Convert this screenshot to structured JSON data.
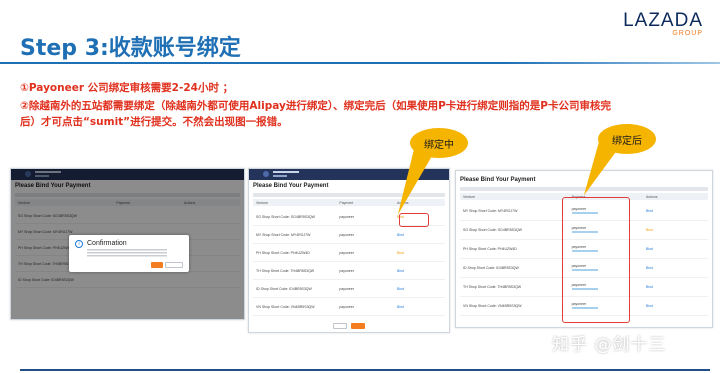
{
  "header": {
    "title": "Step 3:收款账号绑定",
    "logo": {
      "brand": "LAZADA",
      "group": "GROUP"
    }
  },
  "notes": [
    "①Payoneer 公司绑定审核需要2-24小时 ；",
    "②除越南外的五站都需要绑定（除越南外都可使用Alipay进行绑定）、绑定完后（如果使用P卡进行绑定则指的是P卡公司审核完后）才可点击“sumit”进行提交。不然会出现图一报错。"
  ],
  "callouts": {
    "binding": "绑定中",
    "bound": "绑定后"
  },
  "screenshot1": {
    "panel_title": "Please Bind Your Payment",
    "columns": [
      "Venture",
      "Payment",
      "Actions"
    ],
    "rows": [
      {
        "venture": "SG Shop Short Code: SG4BR5S3QW",
        "payment": "",
        "action": ""
      },
      {
        "venture": "MY Shop Short Code: MY4RGJ7W",
        "payment": "",
        "action": ""
      },
      {
        "venture": "PH Shop Short Code: PH4UZW4D",
        "payment": "",
        "action": ""
      },
      {
        "venture": "TH Shop Short Code: TH4BR5S3QW",
        "payment": "",
        "action": ""
      },
      {
        "venture": "ID Shop Short Code: ID4BR5S3QW",
        "payment": "",
        "action": ""
      }
    ],
    "dialog": {
      "title": "Confirmation",
      "icon": "info-icon",
      "ok_label": "Ok",
      "cancel_label": "Cancel"
    }
  },
  "screenshot2": {
    "panel_title": "Please Bind Your Payment",
    "columns": [
      "Venture",
      "Payment",
      "Actions"
    ],
    "rows": [
      {
        "venture": "SG Shop Short Code: SG4BR5S3QW",
        "payment": "payoneer",
        "action": "Bind",
        "status": "review"
      },
      {
        "venture": "MY Shop Short Code: MY4RGJ7W",
        "payment": "payoneer",
        "action": "Bind",
        "status": "bind"
      },
      {
        "venture": "PH Shop Short Code: PH4UZW4D",
        "payment": "payoneer",
        "action": "Bind",
        "status": "review"
      },
      {
        "venture": "TH Shop Short Code: TH4BR5S3QW",
        "payment": "payoneer",
        "action": "Bind",
        "status": "bind"
      },
      {
        "venture": "ID Shop Short Code: ID4BR5S3QW",
        "payment": "payoneer",
        "action": "Bind",
        "status": "bind"
      },
      {
        "venture": "VN Shop Short Code: VN4BR5S3QW",
        "payment": "payoneer",
        "action": "Bind",
        "status": "bind"
      }
    ],
    "buttons": {
      "cancel": "Cancel",
      "submit": "Submit"
    }
  },
  "screenshot3": {
    "panel_title": "Please Bind Your Payment",
    "columns": [
      "Venture",
      "Payment",
      "Actions"
    ],
    "rows": [
      {
        "venture": "MY Shop Short Code: MY4RGJ7W",
        "payment": "payoneer",
        "action": "Bind"
      },
      {
        "venture": "SG Shop Short Code: SG4BR5S3QW",
        "payment": "payoneer",
        "action": "Bind"
      },
      {
        "venture": "PH Shop Short Code: PH4UZW4D",
        "payment": "payoneer",
        "action": "Bind"
      },
      {
        "venture": "ID Shop Short Code: ID4BR5S3QW",
        "payment": "payoneer",
        "action": "Bind"
      },
      {
        "venture": "TH Shop Short Code: TH4BR5S3QW",
        "payment": "payoneer",
        "action": "Bind"
      },
      {
        "venture": "VN Shop Short Code: VN4BR5S3QW",
        "payment": "payoneer",
        "action": "Bind"
      }
    ]
  },
  "watermark": "知乎 @剑十三",
  "colors": {
    "title_blue": "#1f6fb5",
    "note_red": "#e0301e",
    "callout_yellow": "#f5b400",
    "lazada_orange": "#f47d20",
    "highlight_red": "#e53b3b"
  }
}
